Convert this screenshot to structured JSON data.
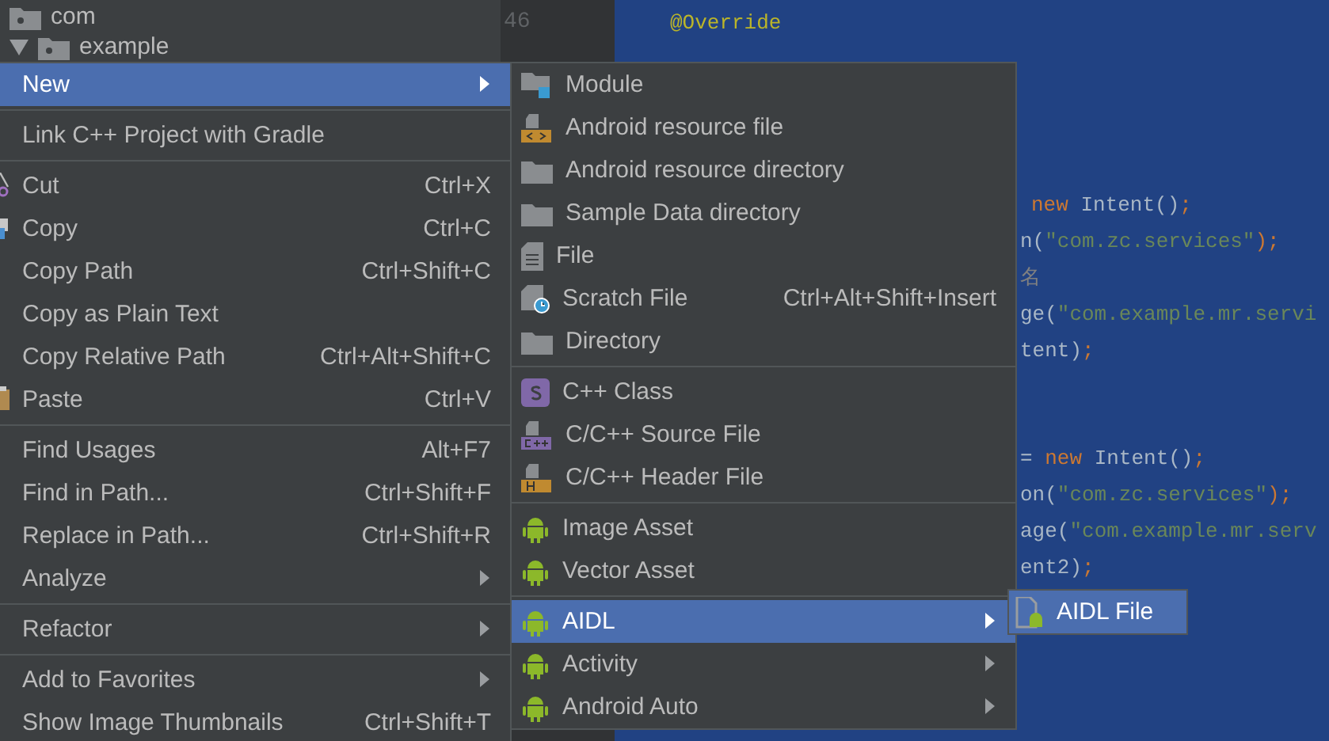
{
  "project_tree": [
    {
      "label": "com"
    },
    {
      "label": "example",
      "expanded": true
    }
  ],
  "editor": {
    "line_numbers": [
      "46"
    ],
    "header_lines": [
      [
        {
          "text": "@Override",
          "kind": "annotation"
        }
      ]
    ],
    "blocks": [
      {
        "lines": [
          [
            {
              "text": "new ",
              "kind": "keyword"
            },
            {
              "text": "Intent()",
              "kind": "plain"
            },
            {
              "text": ";",
              "kind": "keyword"
            }
          ],
          [
            {
              "text": "n(",
              "kind": "plain"
            },
            {
              "text": "\"com.zc.services\"",
              "kind": "string"
            },
            {
              "text": ");",
              "kind": "keyword"
            }
          ],
          [
            {
              "text": "名",
              "kind": "comment"
            }
          ],
          [
            {
              "text": "ge(",
              "kind": "plain"
            },
            {
              "text": "\"com.example.mr.servi",
              "kind": "string"
            }
          ],
          [
            {
              "text": "tent)",
              "kind": "plain"
            },
            {
              "text": ";",
              "kind": "keyword"
            }
          ]
        ]
      },
      {
        "lines": [
          [
            {
              "text": "= ",
              "kind": "plain"
            },
            {
              "text": "new ",
              "kind": "keyword"
            },
            {
              "text": "Intent()",
              "kind": "plain"
            },
            {
              "text": ";",
              "kind": "keyword"
            }
          ],
          [
            {
              "text": "on(",
              "kind": "plain"
            },
            {
              "text": "\"com.zc.services\"",
              "kind": "string"
            },
            {
              "text": ");",
              "kind": "keyword"
            }
          ],
          [
            {
              "text": "age(",
              "kind": "plain"
            },
            {
              "text": "\"com.example.mr.serv",
              "kind": "string"
            }
          ],
          [
            {
              "text": "ent2)",
              "kind": "plain"
            },
            {
              "text": ";",
              "kind": "keyword"
            }
          ]
        ]
      }
    ]
  },
  "context_menu": {
    "groups": [
      [
        {
          "label": "New",
          "has_submenu": true,
          "selected": true
        }
      ],
      [
        {
          "label": "Link C++ Project with Gradle",
          "selected": false
        }
      ],
      [
        {
          "label": "Cut",
          "shortcut": "Ctrl+X",
          "kind": "scissors",
          "selected": false
        },
        {
          "label": "Copy",
          "shortcut": "Ctrl+C",
          "kind": "copy",
          "selected": false
        },
        {
          "label": "Copy Path",
          "shortcut": "Ctrl+Shift+C",
          "selected": false
        },
        {
          "label": "Copy as Plain Text",
          "selected": false
        },
        {
          "label": "Copy Relative Path",
          "shortcut": "Ctrl+Alt+Shift+C",
          "selected": false
        },
        {
          "label": "Paste",
          "shortcut": "Ctrl+V",
          "kind": "clipboard",
          "selected": false
        }
      ],
      [
        {
          "label": "Find Usages",
          "shortcut": "Alt+F7",
          "selected": false
        },
        {
          "label": "Find in Path...",
          "shortcut": "Ctrl+Shift+F",
          "selected": false
        },
        {
          "label": "Replace in Path...",
          "shortcut": "Ctrl+Shift+R",
          "selected": false
        },
        {
          "label": "Analyze",
          "has_submenu": true,
          "selected": false
        }
      ],
      [
        {
          "label": "Refactor",
          "has_submenu": true,
          "selected": false
        }
      ],
      [
        {
          "label": "Add to Favorites",
          "has_submenu": true,
          "selected": false
        },
        {
          "label": "Show Image Thumbnails",
          "shortcut": "Ctrl+Shift+T",
          "selected": false
        }
      ]
    ]
  },
  "new_submenu": {
    "groups": [
      [
        {
          "label": "Module",
          "kind": "module",
          "selected": false
        },
        {
          "label": "Android resource file",
          "kind": "resource",
          "selected": false
        },
        {
          "label": "Android resource directory",
          "kind": "folder",
          "selected": false
        },
        {
          "label": "Sample Data directory",
          "kind": "folder",
          "selected": false
        },
        {
          "label": "File",
          "kind": "file",
          "selected": false
        },
        {
          "label": "Scratch File",
          "shortcut": "Ctrl+Alt+Shift+Insert",
          "kind": "scratch",
          "selected": false
        },
        {
          "label": "Directory",
          "kind": "folder",
          "selected": false
        }
      ],
      [
        {
          "label": "C++ Class",
          "kind": "cpp-class",
          "selected": false
        },
        {
          "label": "C/C++ Source File",
          "kind": "cpp-source",
          "selected": false
        },
        {
          "label": "C/C++ Header File",
          "kind": "cpp-header",
          "selected": false
        }
      ],
      [
        {
          "label": "Image Asset",
          "kind": "android",
          "selected": false
        },
        {
          "label": "Vector Asset",
          "kind": "android",
          "selected": false
        }
      ],
      [
        {
          "label": "AIDL",
          "kind": "android",
          "has_submenu": true,
          "selected": true
        },
        {
          "label": "Activity",
          "kind": "android",
          "has_submenu": true,
          "selected": false
        },
        {
          "label": "Android Auto",
          "kind": "android",
          "has_submenu": true,
          "selected": false
        }
      ]
    ]
  },
  "aidl_submenu": {
    "items": [
      {
        "label": "AIDL File",
        "kind": "aidl-file",
        "selected": true
      }
    ]
  }
}
